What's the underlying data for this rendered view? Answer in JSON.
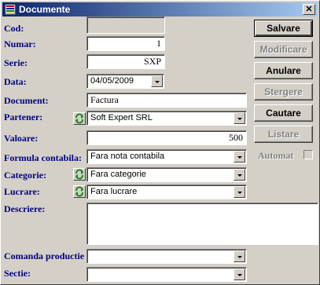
{
  "window": {
    "title": "Documente",
    "close_glyph": "✕"
  },
  "labels": {
    "cod": "Cod:",
    "numar": "Numar:",
    "serie": "Serie:",
    "data": "Data:",
    "document": "Document:",
    "partener": "Partener:",
    "valoare": "Valoare:",
    "formula": "Formula contabila:",
    "categorie": "Categorie:",
    "lucrare": "Lucrare:",
    "descriere": "Descriere:",
    "comanda": "Comanda productie",
    "sectie": "Sectie:"
  },
  "fields": {
    "cod": "",
    "numar": "1",
    "serie": "SXP",
    "data": "04/05/2009",
    "document": "Factura",
    "partener": "Soft Expert SRL",
    "valoare": "500",
    "formula": "Fara nota contabila",
    "categorie": "Fara categorie",
    "lucrare": "Fara lucrare",
    "descriere": "",
    "comanda": "",
    "sectie": ""
  },
  "buttons": {
    "salvare": "Salvare",
    "modificare": "Modificare",
    "anulare": "Anulare",
    "stergere": "Stergere",
    "cautare": "Cautare",
    "listare": "Listare"
  },
  "automat": {
    "label": "Automat",
    "checked": false
  },
  "colors": {
    "label": "#000080",
    "title_start": "#0a246a",
    "title_end": "#a6caf0",
    "refresh": "#1a8a1a"
  }
}
